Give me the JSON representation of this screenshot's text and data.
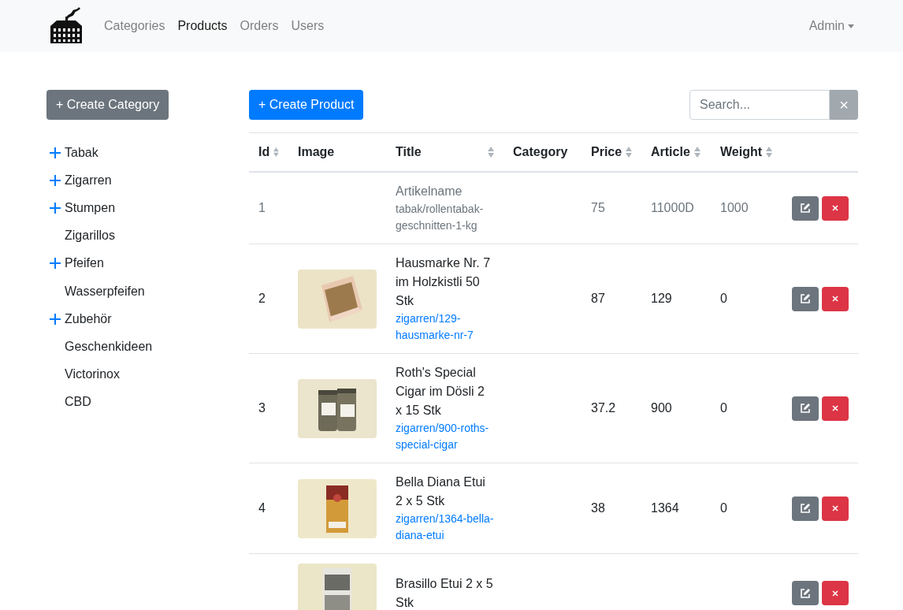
{
  "navbar": {
    "links": [
      {
        "label": "Categories",
        "selected": false
      },
      {
        "label": "Products",
        "selected": true
      },
      {
        "label": "Orders",
        "selected": false
      },
      {
        "label": "Users",
        "selected": false
      }
    ],
    "user_menu": "Admin"
  },
  "sidebar": {
    "create_button": "+ Create Category",
    "items": [
      {
        "label": "Tabak",
        "kind": "group"
      },
      {
        "label": "Zigarren",
        "kind": "group"
      },
      {
        "label": "Stumpen",
        "kind": "group"
      },
      {
        "label": "Zigarillos",
        "kind": "leaf"
      },
      {
        "label": "Pfeifen",
        "kind": "group"
      },
      {
        "label": "Wasserpfeifen",
        "kind": "leaf"
      },
      {
        "label": "Zubehör",
        "kind": "group"
      },
      {
        "label": "Geschenkideen",
        "kind": "leaf"
      },
      {
        "label": "Victorinox",
        "kind": "leaf"
      },
      {
        "label": "CBD",
        "kind": "leaf"
      }
    ]
  },
  "toolbar": {
    "create_button": "+ Create Product",
    "search": {
      "placeholder": "Search..."
    },
    "clear_button": "×"
  },
  "table": {
    "columns": [
      {
        "label": "Id",
        "sortable": true
      },
      {
        "label": "Image",
        "sortable": false
      },
      {
        "label": "Title",
        "sortable": true
      },
      {
        "label": "Category",
        "sortable": false
      },
      {
        "label": "Price",
        "sortable": true
      },
      {
        "label": "Article",
        "sortable": true
      },
      {
        "label": "Weight",
        "sortable": true
      }
    ],
    "rows": [
      {
        "id": "1",
        "image": null,
        "title": "Artikelname",
        "slug": "tabak/rollentabak-geschnitten-1-kg",
        "price": "75",
        "article": "11000D",
        "weight": "1000",
        "active": false
      },
      {
        "id": "2",
        "title": "Hausmarke Nr. 7 im Holzkistli 50 Stk",
        "slug": "zigarren/129-hausmarke-nr-7",
        "price": "87",
        "article": "129",
        "weight": "0",
        "active": true
      },
      {
        "id": "3",
        "title": "Roth's Special Cigar im Dösli 2 x 15 Stk",
        "slug": "zigarren/900-roths-special-cigar",
        "price": "37.2",
        "article": "900",
        "weight": "0",
        "active": true
      },
      {
        "id": "4",
        "title": "Bella Diana Etui 2 x 5 Stk",
        "slug": "zigarren/1364-bella-diana-etui",
        "price": "38",
        "article": "1364",
        "weight": "0",
        "active": true
      },
      {
        "title": "Brasillo Etui 2 x 5 Stk",
        "active": true
      }
    ]
  }
}
